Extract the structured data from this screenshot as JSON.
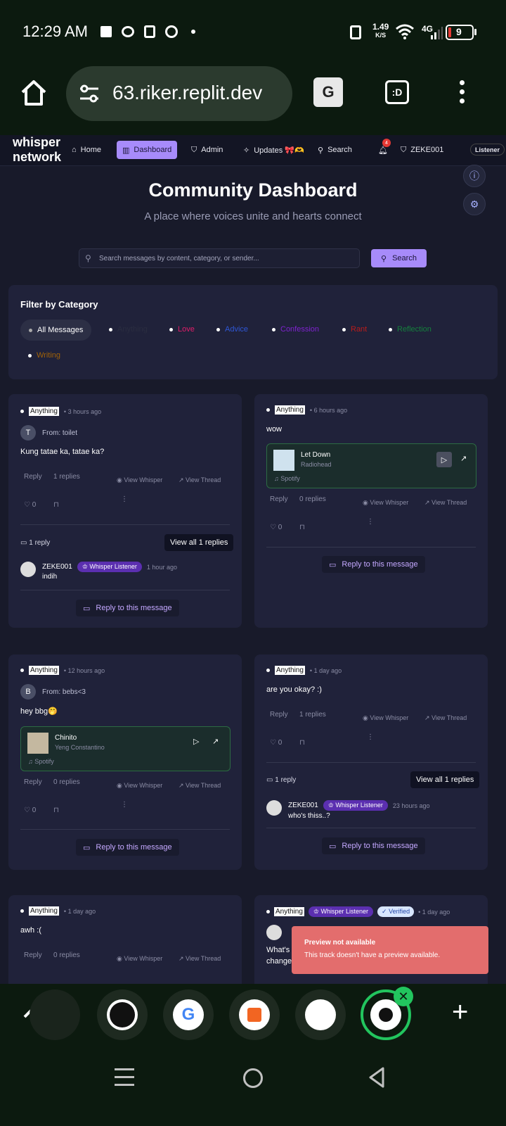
{
  "status": {
    "time": "12:29 AM",
    "speed_value": "1.49",
    "speed_unit": "K/S",
    "network": "4G",
    "battery": "9"
  },
  "browser": {
    "url": "63.riker.replit.dev",
    "tab_badge": ":D"
  },
  "nav": {
    "logo": "whisper network",
    "items": [
      {
        "label": "Home"
      },
      {
        "label": "Dashboard"
      },
      {
        "label": "Admin"
      },
      {
        "label": "Updates 🎀🫶"
      },
      {
        "label": "Search"
      }
    ],
    "notif_count": "4",
    "user": "ZEKE001",
    "role": "Listener"
  },
  "hero": {
    "title": "Community Dashboard",
    "subtitle": "A place where voices unite and hearts connect"
  },
  "search": {
    "placeholder": "Search messages by content, category, or sender...",
    "button": "Search"
  },
  "filter": {
    "heading": "Filter by Category",
    "categories": [
      {
        "label": "All Messages",
        "color": "#ffffff"
      },
      {
        "label": "Anything",
        "color": "#2a2d40"
      },
      {
        "label": "Love",
        "color": "#e11d6a"
      },
      {
        "label": "Advice",
        "color": "#2f57d6"
      },
      {
        "label": "Confession",
        "color": "#7e22ce"
      },
      {
        "label": "Rant",
        "color": "#b91c1c"
      },
      {
        "label": "Reflection",
        "color": "#15803d"
      },
      {
        "label": "Writing",
        "color": "#a16207"
      }
    ]
  },
  "labels": {
    "reply": "Reply",
    "view_whisper": "View Whisper",
    "view_thread": "View Thread",
    "reply_to": "Reply to this message",
    "spotify": "Spotify",
    "whisper_listener": "Whisper Listener",
    "verified": "✓ Verified",
    "zero": "0"
  },
  "cards": [
    {
      "tag": "Anything",
      "time": "• 3 hours ago",
      "from": "From: toilet",
      "avatar": "T",
      "text": "Kung tatae ka, tatae ka?",
      "replies": "1 replies",
      "thread_count": "1 reply",
      "view_all": "View all 1 replies",
      "reply_user": "ZEKE001",
      "reply_time": "1 hour ago",
      "reply_text": "indih"
    },
    {
      "tag": "Anything",
      "time": "• 6 hours ago",
      "text": "wow",
      "track": "Let Down",
      "artist": "Radiohead",
      "replies": "0 replies"
    },
    {
      "tag": "Anything",
      "time": "• 12 hours ago",
      "from": "From: bebs<3",
      "avatar": "B",
      "text": "hey bbg🤭",
      "track": "Chinito",
      "artist": "Yeng Constantino",
      "replies": "0 replies"
    },
    {
      "tag": "Anything",
      "time": "• 1 day ago",
      "text": "are you okay? :)",
      "replies": "1 replies",
      "thread_count": "1 reply",
      "view_all": "View all 1 replies",
      "reply_user": "ZEKE001",
      "reply_time": "23 hours ago",
      "reply_text": "who's thiss..?"
    },
    {
      "tag": "Anything",
      "time": "• 1 day ago",
      "text": "awh :(",
      "replies": "0 replies"
    },
    {
      "tag": "Anything",
      "time": "• 1 day ago",
      "text_a": "What's",
      "text_b": "change"
    }
  ],
  "toast": {
    "title": "Preview not available",
    "body": "This track doesn't have a preview available.",
    "color": "#e36d6d"
  }
}
